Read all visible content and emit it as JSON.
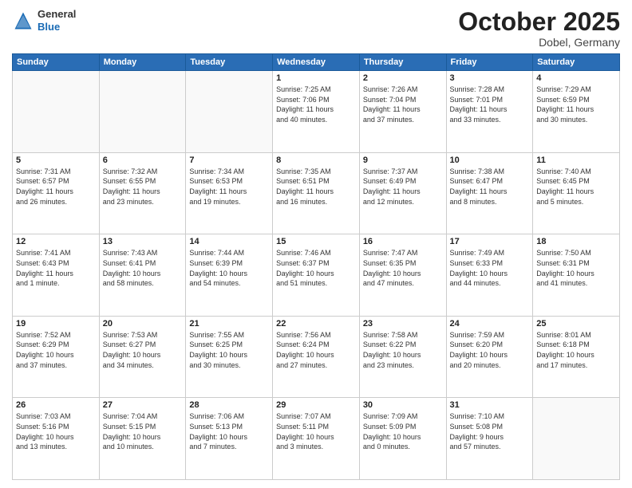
{
  "header": {
    "logo_general": "General",
    "logo_blue": "Blue",
    "month": "October 2025",
    "location": "Dobel, Germany"
  },
  "weekdays": [
    "Sunday",
    "Monday",
    "Tuesday",
    "Wednesday",
    "Thursday",
    "Friday",
    "Saturday"
  ],
  "weeks": [
    [
      {
        "day": "",
        "info": ""
      },
      {
        "day": "",
        "info": ""
      },
      {
        "day": "",
        "info": ""
      },
      {
        "day": "1",
        "info": "Sunrise: 7:25 AM\nSunset: 7:06 PM\nDaylight: 11 hours\nand 40 minutes."
      },
      {
        "day": "2",
        "info": "Sunrise: 7:26 AM\nSunset: 7:04 PM\nDaylight: 11 hours\nand 37 minutes."
      },
      {
        "day": "3",
        "info": "Sunrise: 7:28 AM\nSunset: 7:01 PM\nDaylight: 11 hours\nand 33 minutes."
      },
      {
        "day": "4",
        "info": "Sunrise: 7:29 AM\nSunset: 6:59 PM\nDaylight: 11 hours\nand 30 minutes."
      }
    ],
    [
      {
        "day": "5",
        "info": "Sunrise: 7:31 AM\nSunset: 6:57 PM\nDaylight: 11 hours\nand 26 minutes."
      },
      {
        "day": "6",
        "info": "Sunrise: 7:32 AM\nSunset: 6:55 PM\nDaylight: 11 hours\nand 23 minutes."
      },
      {
        "day": "7",
        "info": "Sunrise: 7:34 AM\nSunset: 6:53 PM\nDaylight: 11 hours\nand 19 minutes."
      },
      {
        "day": "8",
        "info": "Sunrise: 7:35 AM\nSunset: 6:51 PM\nDaylight: 11 hours\nand 16 minutes."
      },
      {
        "day": "9",
        "info": "Sunrise: 7:37 AM\nSunset: 6:49 PM\nDaylight: 11 hours\nand 12 minutes."
      },
      {
        "day": "10",
        "info": "Sunrise: 7:38 AM\nSunset: 6:47 PM\nDaylight: 11 hours\nand 8 minutes."
      },
      {
        "day": "11",
        "info": "Sunrise: 7:40 AM\nSunset: 6:45 PM\nDaylight: 11 hours\nand 5 minutes."
      }
    ],
    [
      {
        "day": "12",
        "info": "Sunrise: 7:41 AM\nSunset: 6:43 PM\nDaylight: 11 hours\nand 1 minute."
      },
      {
        "day": "13",
        "info": "Sunrise: 7:43 AM\nSunset: 6:41 PM\nDaylight: 10 hours\nand 58 minutes."
      },
      {
        "day": "14",
        "info": "Sunrise: 7:44 AM\nSunset: 6:39 PM\nDaylight: 10 hours\nand 54 minutes."
      },
      {
        "day": "15",
        "info": "Sunrise: 7:46 AM\nSunset: 6:37 PM\nDaylight: 10 hours\nand 51 minutes."
      },
      {
        "day": "16",
        "info": "Sunrise: 7:47 AM\nSunset: 6:35 PM\nDaylight: 10 hours\nand 47 minutes."
      },
      {
        "day": "17",
        "info": "Sunrise: 7:49 AM\nSunset: 6:33 PM\nDaylight: 10 hours\nand 44 minutes."
      },
      {
        "day": "18",
        "info": "Sunrise: 7:50 AM\nSunset: 6:31 PM\nDaylight: 10 hours\nand 41 minutes."
      }
    ],
    [
      {
        "day": "19",
        "info": "Sunrise: 7:52 AM\nSunset: 6:29 PM\nDaylight: 10 hours\nand 37 minutes."
      },
      {
        "day": "20",
        "info": "Sunrise: 7:53 AM\nSunset: 6:27 PM\nDaylight: 10 hours\nand 34 minutes."
      },
      {
        "day": "21",
        "info": "Sunrise: 7:55 AM\nSunset: 6:25 PM\nDaylight: 10 hours\nand 30 minutes."
      },
      {
        "day": "22",
        "info": "Sunrise: 7:56 AM\nSunset: 6:24 PM\nDaylight: 10 hours\nand 27 minutes."
      },
      {
        "day": "23",
        "info": "Sunrise: 7:58 AM\nSunset: 6:22 PM\nDaylight: 10 hours\nand 23 minutes."
      },
      {
        "day": "24",
        "info": "Sunrise: 7:59 AM\nSunset: 6:20 PM\nDaylight: 10 hours\nand 20 minutes."
      },
      {
        "day": "25",
        "info": "Sunrise: 8:01 AM\nSunset: 6:18 PM\nDaylight: 10 hours\nand 17 minutes."
      }
    ],
    [
      {
        "day": "26",
        "info": "Sunrise: 7:03 AM\nSunset: 5:16 PM\nDaylight: 10 hours\nand 13 minutes."
      },
      {
        "day": "27",
        "info": "Sunrise: 7:04 AM\nSunset: 5:15 PM\nDaylight: 10 hours\nand 10 minutes."
      },
      {
        "day": "28",
        "info": "Sunrise: 7:06 AM\nSunset: 5:13 PM\nDaylight: 10 hours\nand 7 minutes."
      },
      {
        "day": "29",
        "info": "Sunrise: 7:07 AM\nSunset: 5:11 PM\nDaylight: 10 hours\nand 3 minutes."
      },
      {
        "day": "30",
        "info": "Sunrise: 7:09 AM\nSunset: 5:09 PM\nDaylight: 10 hours\nand 0 minutes."
      },
      {
        "day": "31",
        "info": "Sunrise: 7:10 AM\nSunset: 5:08 PM\nDaylight: 9 hours\nand 57 minutes."
      },
      {
        "day": "",
        "info": ""
      }
    ]
  ]
}
